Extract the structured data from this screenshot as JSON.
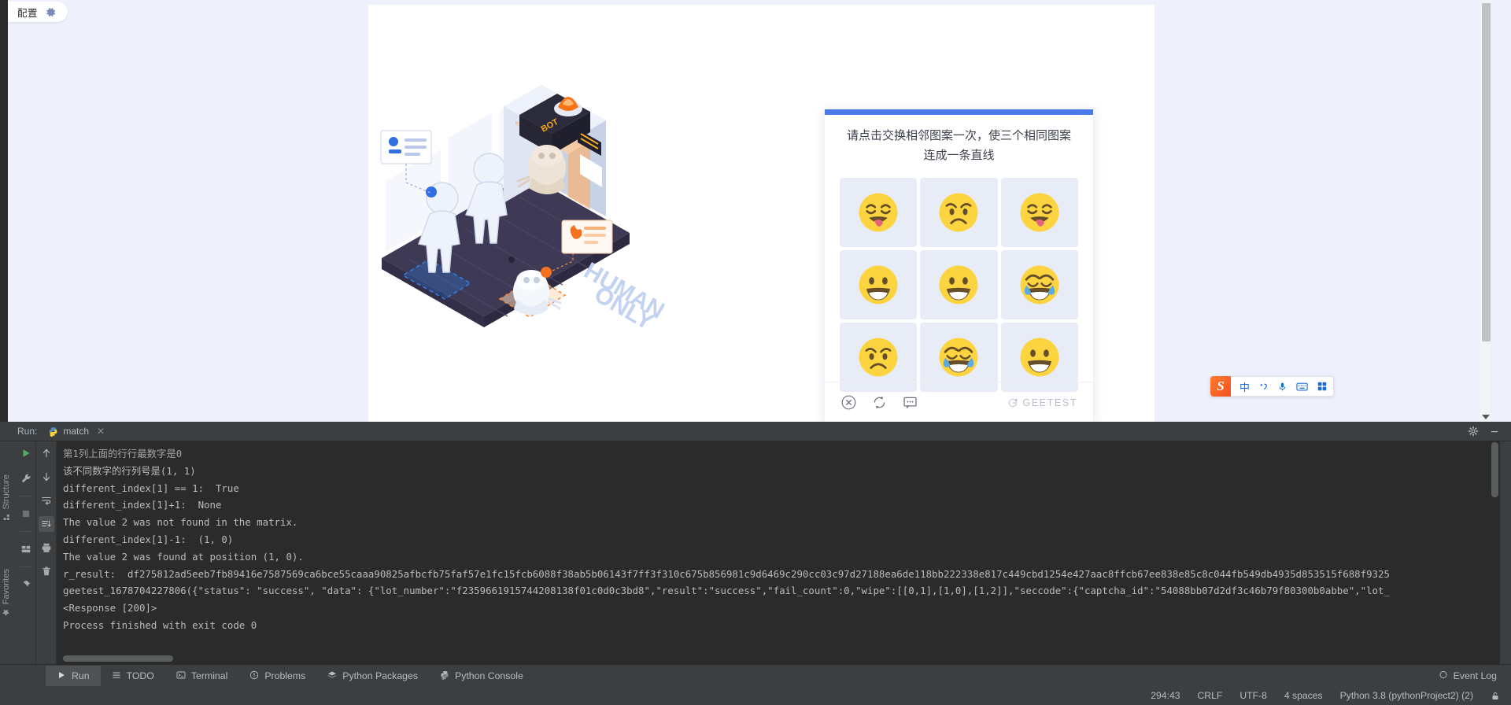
{
  "config_pill": {
    "label": "配置",
    "gear_icon": "gear-icon"
  },
  "illustration": {
    "gate_label": "BOT",
    "floor_text_line1": "HUMAN",
    "floor_text_line2": "ONLY"
  },
  "captcha": {
    "title": "请点击交换相邻图案一次，使三个相同图案连成一条直线",
    "accent_color": "#4a7ae8",
    "cell_bg": "#e7ecf6",
    "grid": [
      [
        {
          "emoji": "squint-tongue-face",
          "name": "emoji-tongue-squint"
        },
        {
          "emoji": "worried-face",
          "name": "emoji-worried"
        },
        {
          "emoji": "squint-tongue-face",
          "name": "emoji-tongue-squint"
        }
      ],
      [
        {
          "emoji": "grinning-face",
          "name": "emoji-grinning"
        },
        {
          "emoji": "grinning-face",
          "name": "emoji-grinning"
        },
        {
          "emoji": "tears-of-joy-face",
          "name": "emoji-joy"
        }
      ],
      [
        {
          "emoji": "worried-face",
          "name": "emoji-worried"
        },
        {
          "emoji": "tears-of-joy-face",
          "name": "emoji-joy"
        },
        {
          "emoji": "grinning-face",
          "name": "emoji-grinning"
        }
      ]
    ],
    "footer": {
      "close_icon": "close-circle-icon",
      "refresh_icon": "refresh-icon",
      "feedback_icon": "feedback-icon",
      "brand": "GEETEST"
    }
  },
  "ime": {
    "logo": "S",
    "items": [
      "中",
      "，",
      "mic-icon",
      "keyboard-icon",
      "apps-icon"
    ]
  },
  "run_panel": {
    "label": "Run:",
    "tab_name": "match",
    "tab_close": "✕",
    "gear_icon": "gear-icon",
    "minimize_icon": "minimize-icon",
    "toolbar_left": [
      "rerun-icon",
      "wrench-icon",
      "stop-icon",
      "layout-icon",
      "pin-icon"
    ],
    "toolbar_right": [
      "scroll-up-icon",
      "scroll-down-icon",
      "soft-wrap-icon",
      "filter-icon",
      "print-icon",
      "trash-icon"
    ],
    "side_tabs": [
      "Structure",
      "Favorites"
    ]
  },
  "console": {
    "lines": [
      "该不同数字的行列号是(1, 1)",
      "different_index[1] == 1:  True",
      "different_index[1]+1:  None",
      "The value 2 was not found in the matrix.",
      "different_index[1]-1:  (1, 0)",
      "The value 2 was found at position (1, 0).",
      "r_result:  df275812ad5eeb7fb89416e7587569ca6bce55caaa90825afbcfb75faf57e1fc15fcb6088f38ab5b06143f7ff3f310c675b856981c9d6469c290cc03c97d27188ea6de118bb222338e817c449cbd1254e427aac8ffcb67ee838e85c8c044fb549db4935d853515f688f9325",
      "geetest_1678704227806({\"status\": \"success\", \"data\": {\"lot_number\":\"f2359661915744208138f01c0d0c3bd8\",\"result\":\"success\",\"fail_count\":0,\"wipe\":[[0,1],[1,0],[1,2]],\"seccode\":{\"captcha_id\":\"54088bb07d2df3c46b79f80300b0abbe\",\"lot_",
      "<Response [200]>",
      "",
      "Process finished with exit code 0"
    ],
    "clipped_first_line": "第1列上面的行行最数字是0"
  },
  "bottom_toolbar": {
    "items": [
      {
        "label": "Run",
        "icon": "run-icon",
        "active": true
      },
      {
        "label": "TODO",
        "icon": "todo-icon",
        "active": false
      },
      {
        "label": "Terminal",
        "icon": "terminal-icon",
        "active": false
      },
      {
        "label": "Problems",
        "icon": "problems-icon",
        "active": false
      },
      {
        "label": "Python Packages",
        "icon": "packages-icon",
        "active": false
      },
      {
        "label": "Python Console",
        "icon": "python-icon",
        "active": false
      }
    ],
    "event_log": "Event Log",
    "event_log_icon": "balloon-icon"
  },
  "status_bar": {
    "caret": "294:43",
    "line_sep": "CRLF",
    "encoding": "UTF-8",
    "indent": "4 spaces",
    "interpreter": "Python 3.8 (pythonProject2) (2)",
    "lock_icon": "lock-icon"
  }
}
